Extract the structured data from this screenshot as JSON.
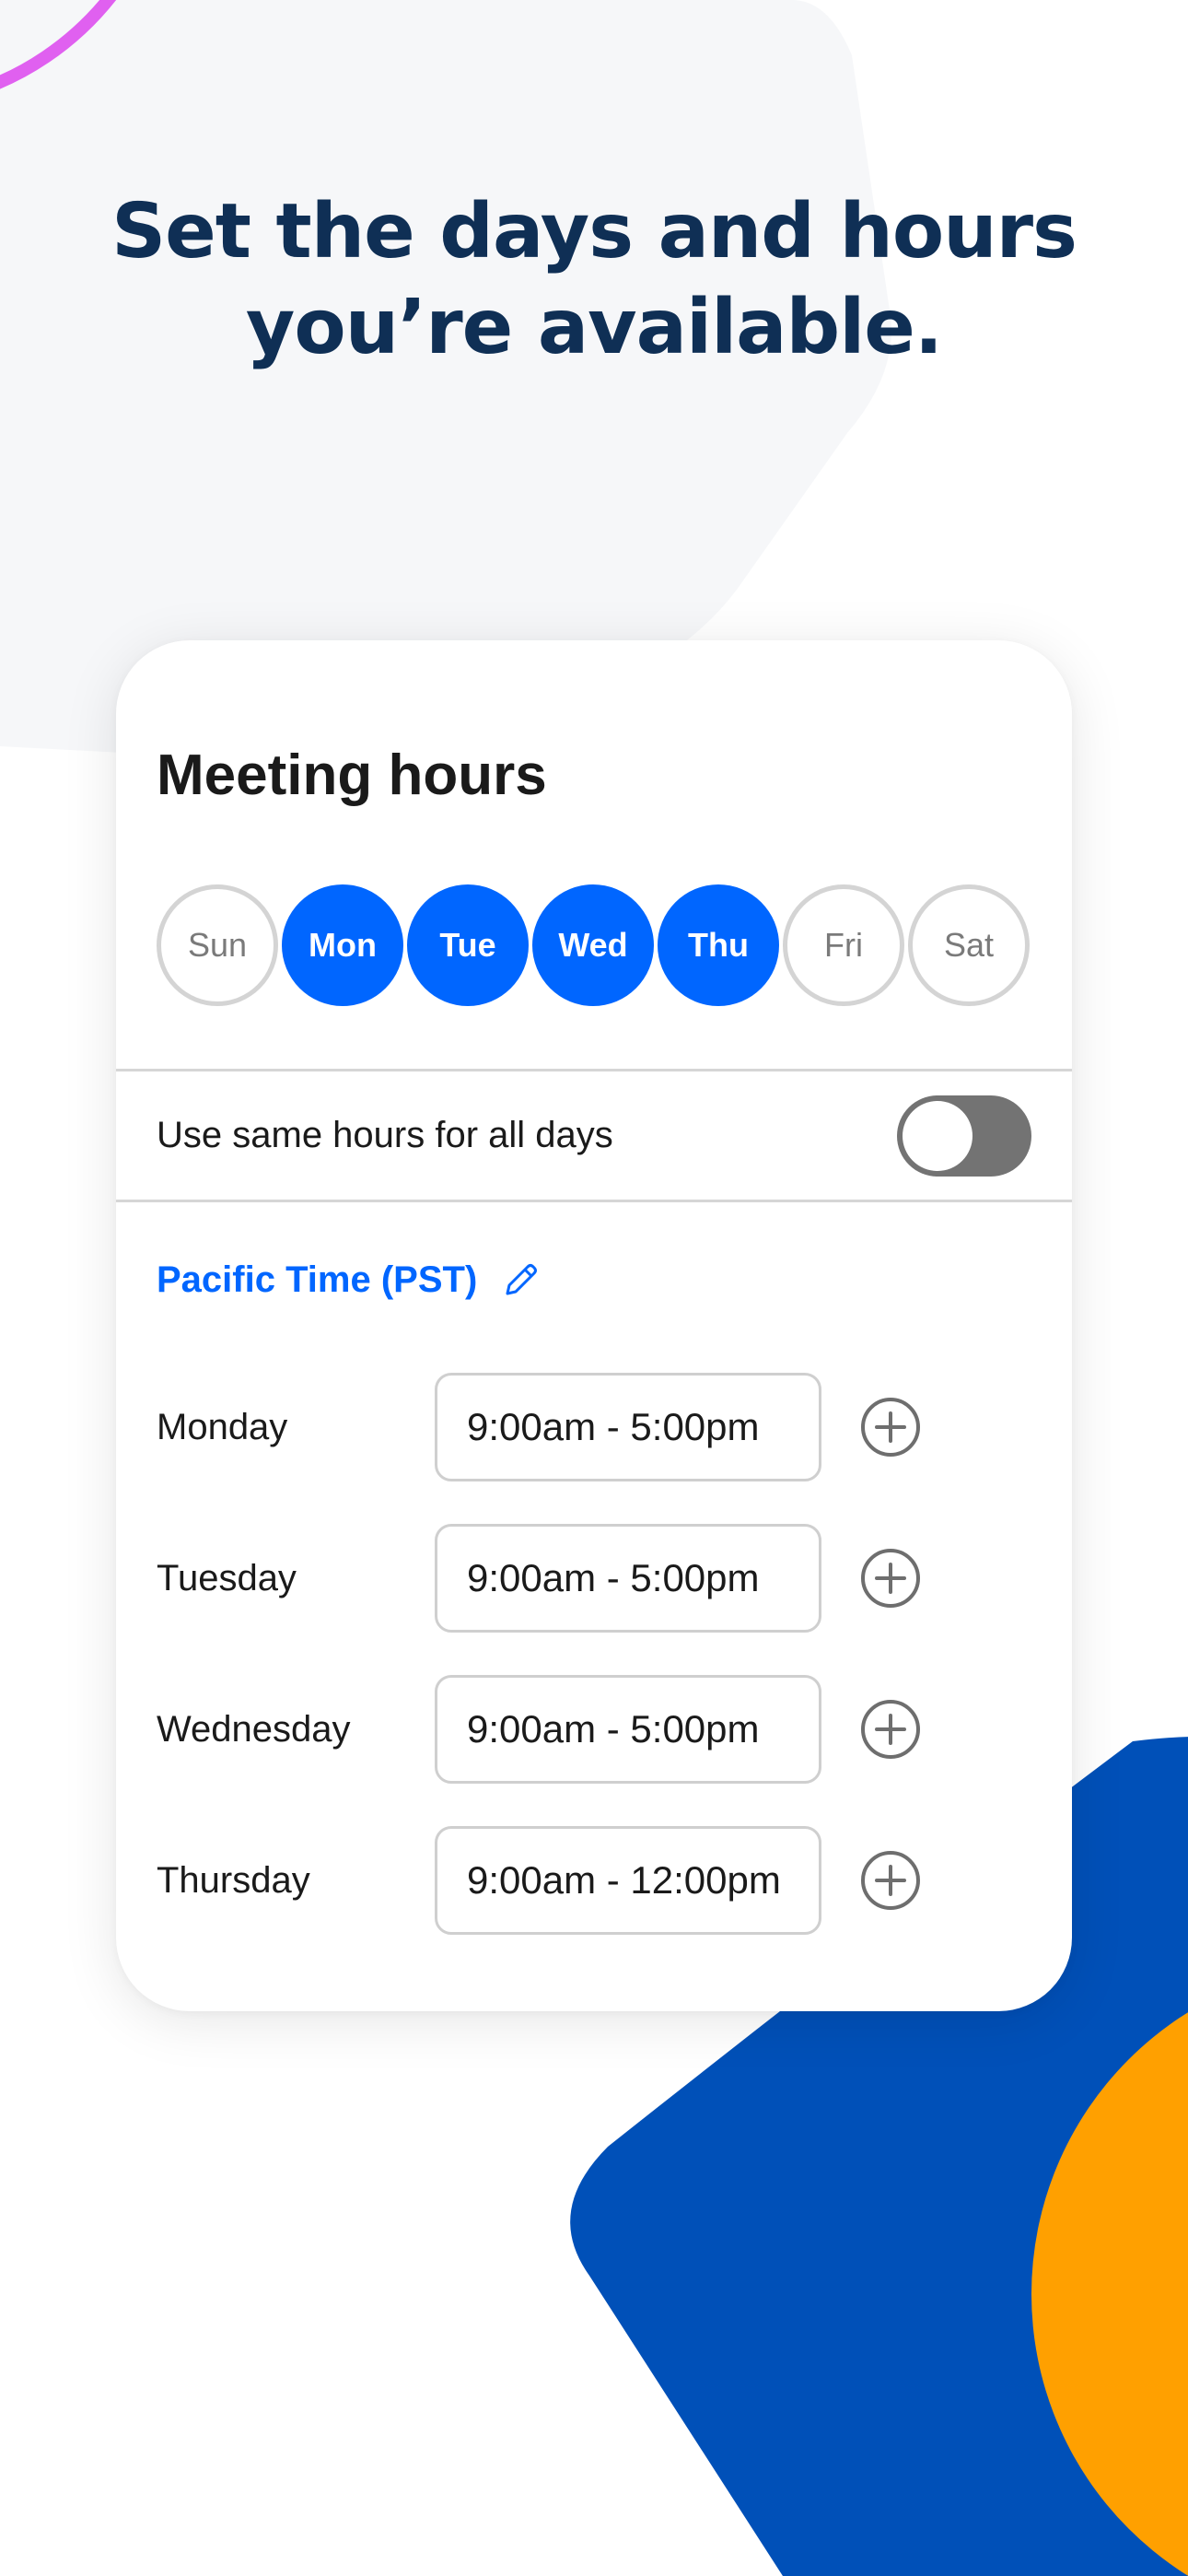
{
  "headline": {
    "line1": "Set the days and hours",
    "line2": "you’re available."
  },
  "card": {
    "title": "Meeting hours",
    "days": [
      {
        "label": "Sun",
        "selected": false
      },
      {
        "label": "Mon",
        "selected": true
      },
      {
        "label": "Tue",
        "selected": true
      },
      {
        "label": "Wed",
        "selected": true
      },
      {
        "label": "Thu",
        "selected": true
      },
      {
        "label": "Fri",
        "selected": false
      },
      {
        "label": "Sat",
        "selected": false
      }
    ],
    "same_hours": {
      "label": "Use same hours for all days",
      "enabled": false
    },
    "timezone": {
      "label": "Pacific Time (PST)",
      "icon": "pencil-icon"
    },
    "schedule": [
      {
        "day": "Monday",
        "hours": "9:00am - 5:00pm"
      },
      {
        "day": "Tuesday",
        "hours": "9:00am - 5:00pm"
      },
      {
        "day": "Wednesday",
        "hours": "9:00am - 5:00pm"
      },
      {
        "day": "Thursday",
        "hours": "9:00am - 12:00pm"
      }
    ],
    "add_icon": "plus-circle-icon"
  },
  "colors": {
    "accent_blue": "#0066ff",
    "headline_navy": "#0f2f55",
    "bg_shape_blue": "#0050b8",
    "bg_shape_orange": "#ffa000",
    "bg_arc_pink": "#e060f0",
    "toggle_off": "#737373"
  }
}
